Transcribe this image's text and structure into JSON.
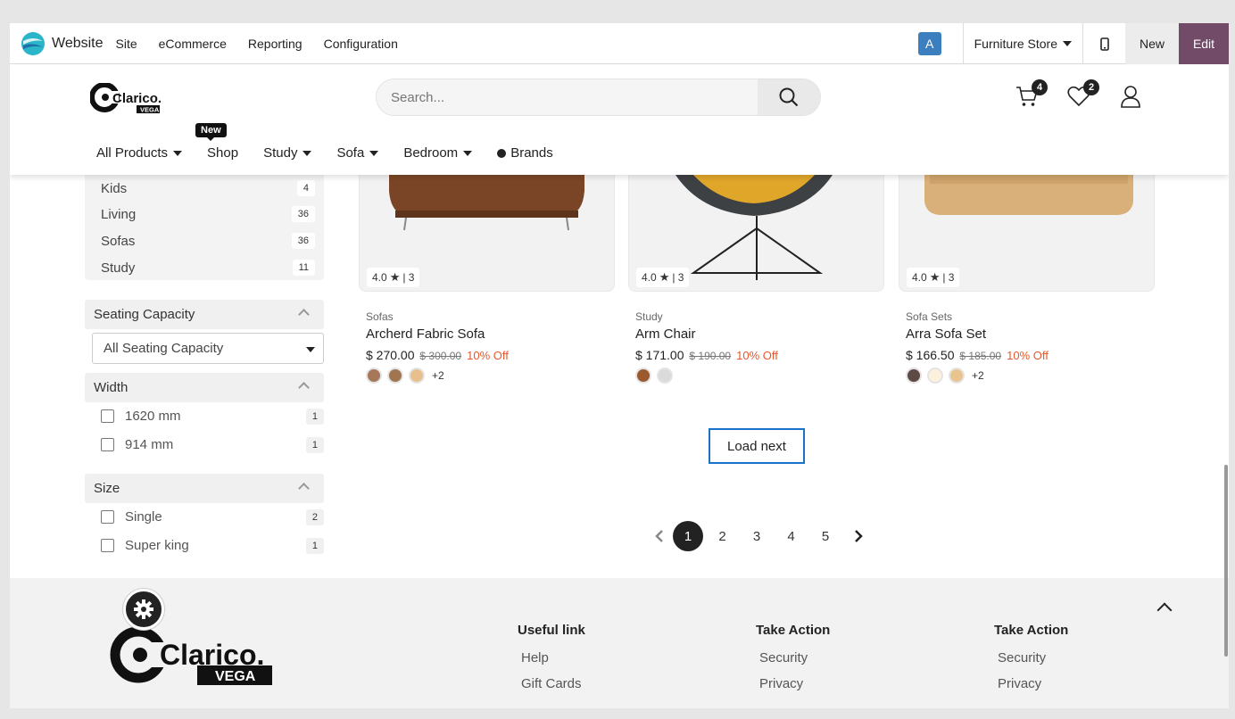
{
  "topbar": {
    "app_name": "Website",
    "menu": [
      "Site",
      "eCommerce",
      "Reporting",
      "Configuration"
    ],
    "avatar_letter": "A",
    "store_label": "Furniture Store",
    "new_label": "New",
    "edit_label": "Edit"
  },
  "header": {
    "brand_name": "Clarico.",
    "brand_sub": "VEGA",
    "search_placeholder": "Search...",
    "cart_count": "4",
    "wishlist_count": "2"
  },
  "nav": {
    "items": [
      "All Products",
      "Shop",
      "Study",
      "Sofa",
      "Bedroom",
      "Brands"
    ],
    "new_tag": "New"
  },
  "sidebar": {
    "categories": [
      {
        "label": "Kids",
        "count": "4"
      },
      {
        "label": "Living",
        "count": "36"
      },
      {
        "label": "Sofas",
        "count": "36"
      },
      {
        "label": "Study",
        "count": "11"
      }
    ],
    "seating": {
      "title": "Seating Capacity",
      "selected": "All Seating Capacity"
    },
    "width": {
      "title": "Width",
      "options": [
        {
          "label": "1620 mm",
          "count": "1"
        },
        {
          "label": "914 mm",
          "count": "1"
        }
      ]
    },
    "size": {
      "title": "Size",
      "options": [
        {
          "label": "Single",
          "count": "2"
        },
        {
          "label": "Super king",
          "count": "1"
        }
      ]
    }
  },
  "products": [
    {
      "rating": "4.0",
      "reviews": "3",
      "category": "Sofas",
      "name": "Archerd Fabric Sofa",
      "price": "$ 270.00",
      "old_price": "$ 300.00",
      "discount": "10% Off",
      "swatches": [
        "#a7775a",
        "#a07552",
        "#e7c08e"
      ],
      "more": "+2"
    },
    {
      "rating": "4.0",
      "reviews": "3",
      "category": "Study",
      "name": "Arm Chair",
      "price": "$ 171.00",
      "old_price": "$ 190.00",
      "discount": "10% Off",
      "swatches": [
        "#9b5a2e",
        "#dadada"
      ],
      "more": ""
    },
    {
      "rating": "4.0",
      "reviews": "3",
      "category": "Sofa Sets",
      "name": "Arra Sofa Set",
      "price": "$ 166.50",
      "old_price": "$ 185.00",
      "discount": "10% Off",
      "swatches": [
        "#5e4a45",
        "#fbf1dc",
        "#e9c48f"
      ],
      "more": "+2"
    }
  ],
  "load_next": "Load next",
  "pagination": [
    "1",
    "2",
    "3",
    "4",
    "5"
  ],
  "footer": {
    "col1": {
      "title": "Useful link",
      "links": [
        "Help",
        "Gift Cards"
      ]
    },
    "col2": {
      "title": "Take Action",
      "links": [
        "Security",
        "Privacy"
      ]
    },
    "col3": {
      "title": "Take Action",
      "links": [
        "Security",
        "Privacy"
      ]
    }
  }
}
